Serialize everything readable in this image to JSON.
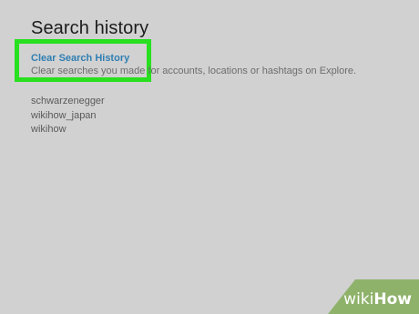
{
  "page": {
    "title": "Search history"
  },
  "clear_section": {
    "link_label": "Clear Search History",
    "description": "Clear searches you made for accounts, locations or hashtags on Explore."
  },
  "history": {
    "items": [
      "schwarzenegger",
      "wikihow_japan",
      "wikihow"
    ]
  },
  "watermark": {
    "wiki": "wiki",
    "how": "How"
  },
  "colors": {
    "background": "#d1d1d1",
    "highlight": "#28e01f",
    "link": "#2f7fb3",
    "watermark": "#8fb26b"
  }
}
